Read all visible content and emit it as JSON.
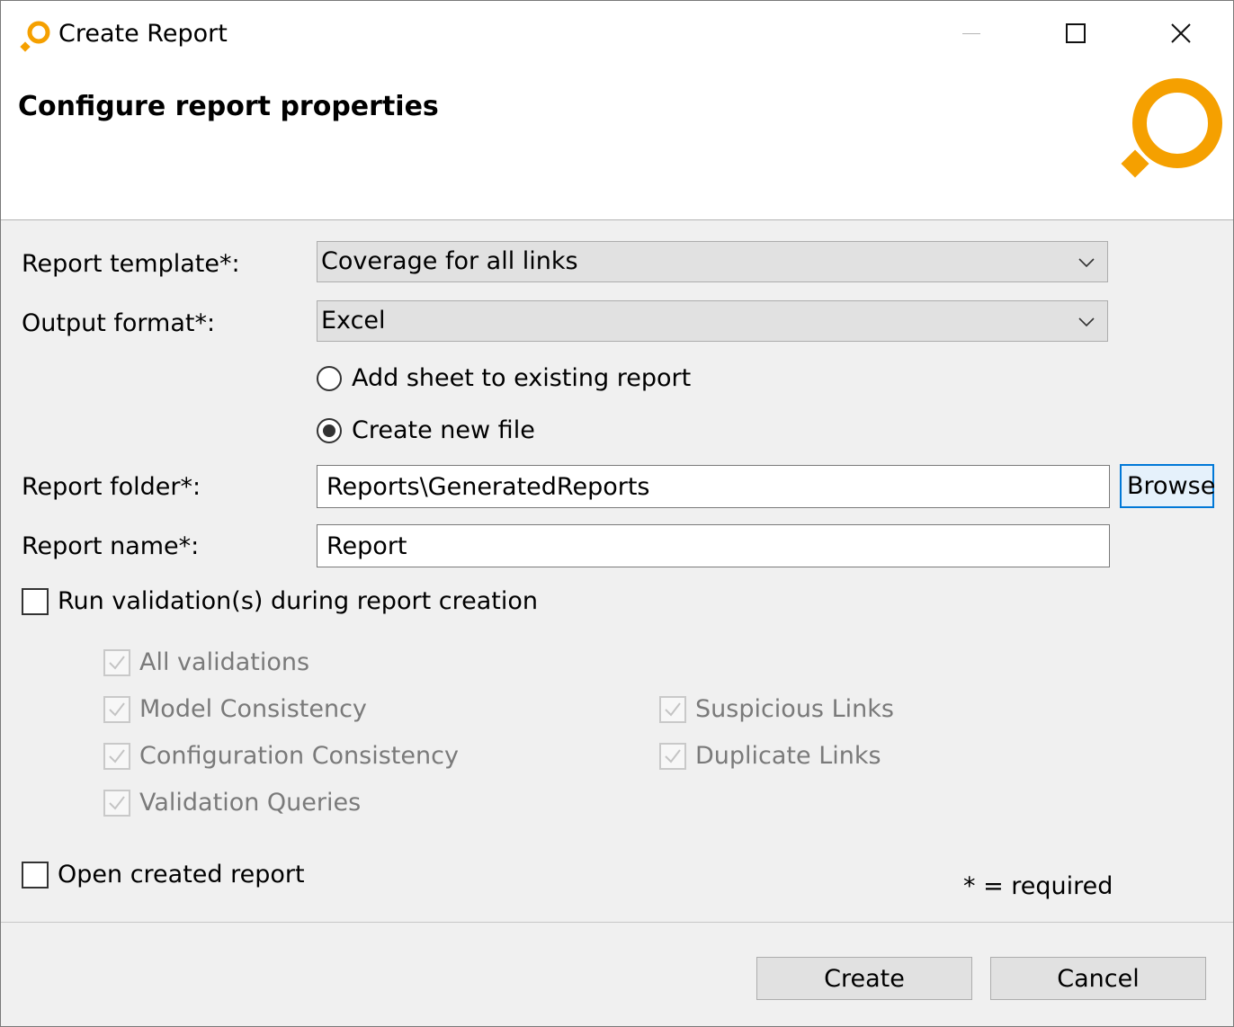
{
  "window": {
    "title": "Create Report",
    "icon": "app-logo-icon",
    "controls": [
      "minimize-icon",
      "maximize-icon",
      "close-icon"
    ]
  },
  "header": {
    "title": "Configure report properties",
    "accent_color": "#f5a000"
  },
  "form": {
    "template_label": "Report template*:",
    "template_value": "Coverage for all links",
    "format_label": "Output format*:",
    "format_value": "Excel",
    "radio_add_sheet": "Add sheet to existing report",
    "radio_new_file": "Create new file",
    "selected_radio": "Create new file",
    "folder_label": "Report folder*:",
    "folder_value": "Reports\\GeneratedReports",
    "browse_label": "Browse",
    "name_label": "Report name*:",
    "name_value": "Report",
    "run_validation_label": "Run validation(s) during report creation",
    "run_validation_checked": false,
    "validations": {
      "all": "All validations",
      "model": "Model Consistency",
      "configuration": "Configuration Consistency",
      "queries": "Validation Queries",
      "suspicious": "Suspicious Links",
      "duplicate": "Duplicate Links",
      "enabled": false,
      "checked": true
    },
    "open_report_label": "Open created report",
    "open_report_checked": false,
    "required_note": "* = required"
  },
  "footer": {
    "create_label": "Create",
    "cancel_label": "Cancel"
  }
}
